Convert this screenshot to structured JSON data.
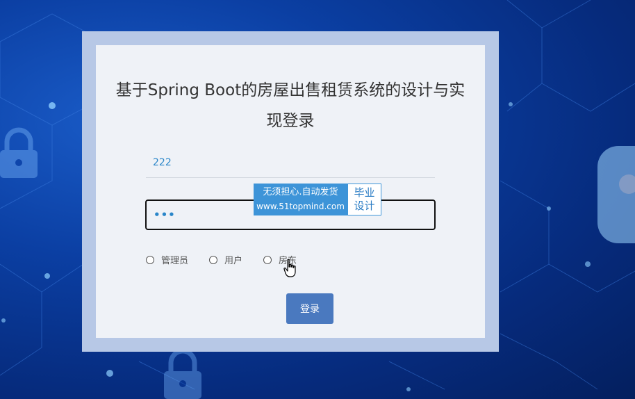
{
  "title": "基于Spring Boot的房屋出售租赁系统的设计与实现登录",
  "username": {
    "value": "222"
  },
  "password": {
    "value": "•••"
  },
  "watermark": {
    "line1": "无须担心.自动发货",
    "line2": "www.51topmind.com",
    "badge_line1": "毕业",
    "badge_line2": "设计"
  },
  "roles": [
    {
      "label": "管理员",
      "selected": false
    },
    {
      "label": "用户",
      "selected": false
    },
    {
      "label": "房东",
      "selected": false
    }
  ],
  "login_button": "登录",
  "colors": {
    "accent": "#4a79bf",
    "input_text": "#2a86c9",
    "card_bg": "#eff2f7",
    "card_border": "#b7c8e6"
  },
  "icons": {
    "background": [
      "lock-icon",
      "network-node-icon"
    ],
    "cursor": "hand-pointer-icon"
  }
}
